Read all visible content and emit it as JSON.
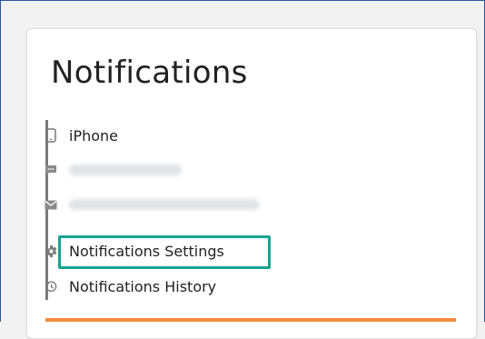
{
  "card": {
    "title": "Notifications",
    "contacts": [
      {
        "icon": "phone-icon",
        "label": "iPhone"
      },
      {
        "icon": "message-icon",
        "label": ""
      },
      {
        "icon": "mail-icon",
        "label": ""
      }
    ],
    "links": [
      {
        "icon": "gear-icon",
        "label": "Notifications Settings"
      },
      {
        "icon": "history-icon",
        "label": "Notifications History"
      }
    ]
  },
  "colors": {
    "highlight": "#1aa391",
    "accent_bar": "#f28b3b",
    "group_bar": "#7a7a7a"
  }
}
